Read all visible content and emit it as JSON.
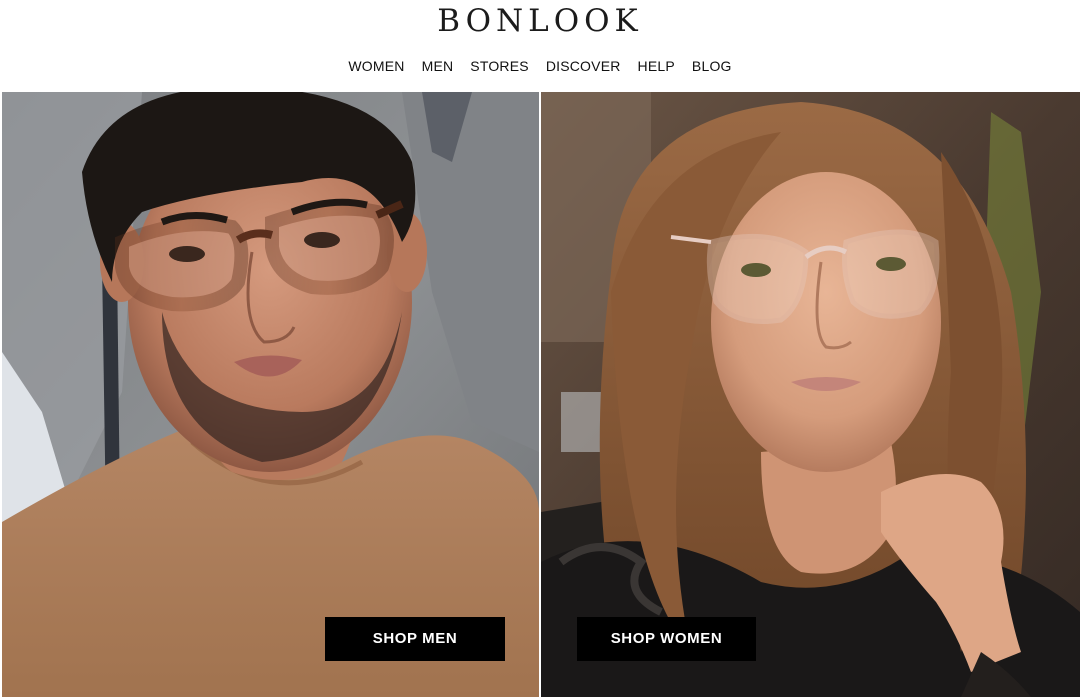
{
  "brand": {
    "logo_text": "BONLOOK"
  },
  "nav": {
    "items": [
      {
        "label": "WOMEN"
      },
      {
        "label": "MEN"
      },
      {
        "label": "STORES"
      },
      {
        "label": "DISCOVER"
      },
      {
        "label": "HELP"
      },
      {
        "label": "BLOG"
      }
    ]
  },
  "hero": {
    "men": {
      "cta_label": "SHOP MEN",
      "image_subject": "man-wearing-tortoiseshell-glasses"
    },
    "women": {
      "cta_label": "SHOP WOMEN",
      "image_subject": "woman-wearing-clear-glasses"
    }
  },
  "colors": {
    "header_bg": "#ffffff",
    "nav_text": "#111111",
    "button_bg": "#000000",
    "button_text": "#ffffff"
  }
}
